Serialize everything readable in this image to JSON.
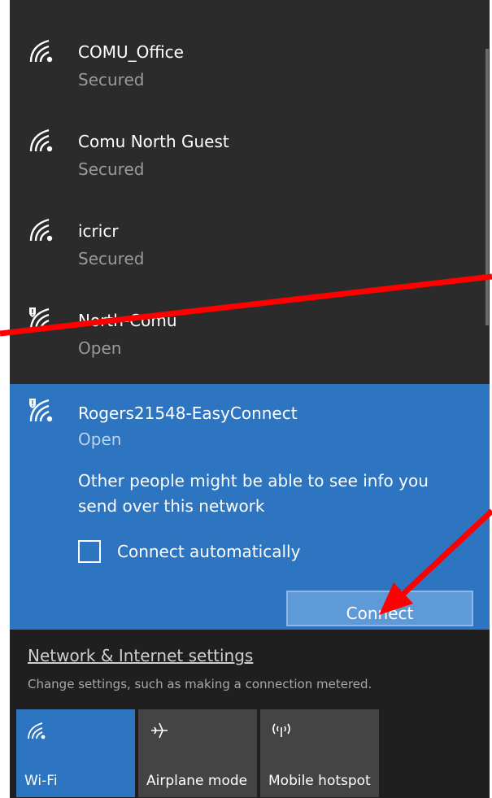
{
  "networks": [
    {
      "name": "COMU_Office",
      "status": "Secured",
      "icon": "wifi-icon"
    },
    {
      "name": "Comu North Guest",
      "status": "Secured",
      "icon": "wifi-icon"
    },
    {
      "name": "icricr",
      "status": "Secured",
      "icon": "wifi-icon"
    },
    {
      "name": "North-Comu",
      "status": "Open",
      "icon": "wifi-open-warning-icon"
    }
  ],
  "selected_network": {
    "name": "Rogers21548-EasyConnect",
    "status": "Open",
    "icon": "wifi-open-warning-icon",
    "warning": "Other people might be able to see info you send over this network",
    "auto_connect_label": "Connect automatically",
    "auto_connect_checked": false,
    "connect_label": "Connect"
  },
  "settings": {
    "link_label": "Network & Internet settings",
    "description": "Change settings, such as making a connection metered."
  },
  "quick_actions": [
    {
      "label": "Wi-Fi",
      "icon": "wifi-icon",
      "active": true
    },
    {
      "label": "Airplane mode",
      "icon": "airplane-icon",
      "active": false
    },
    {
      "label": "Mobile hotspot",
      "icon": "hotspot-icon",
      "active": false
    }
  ],
  "colors": {
    "background": "#2b2b2b",
    "accent": "#2d74c1",
    "annotation": "#ff0000"
  }
}
